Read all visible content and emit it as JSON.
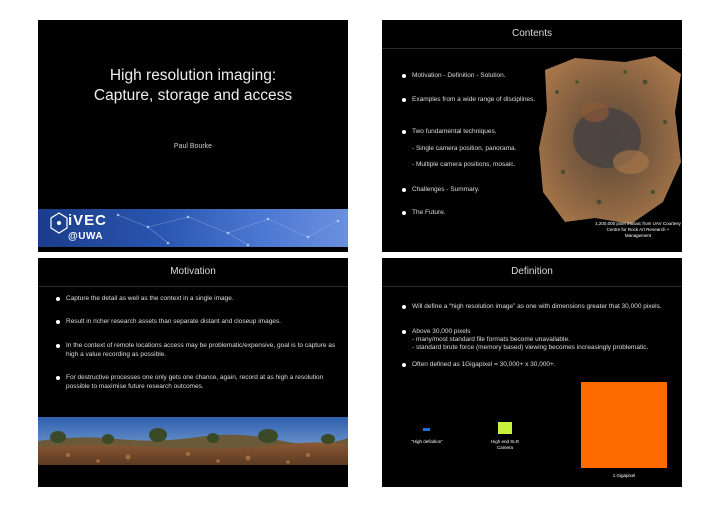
{
  "slide1": {
    "title_line1": "High resolution imaging:",
    "title_line2": "Capture, storage and access",
    "author": "Paul Bourke",
    "logo_top": "iVEC",
    "logo_bottom": "@UWA"
  },
  "slide2": {
    "title": "Contents",
    "bullets": [
      "Motivation - Definition - Solution.",
      "Examples from a wide range of disciplines.",
      "Two fundamental techniques.",
      "- Single camera position, panorama.",
      "- Multiple camera positions, mosaic.",
      "Challenges - Summary.",
      "The Future."
    ],
    "caption": "1,200,000 pixel mosaic from UAV Courtesy Centre for Rock Art Research + Management"
  },
  "slide3": {
    "title": "Motivation",
    "bullets": [
      "Capture the detail as well as the context in a single image.",
      "Result in richer research assets than separate distant and closeup images.",
      "In the context of remote locations access may be problematic/expensive, goal is to capture as high a value recording as possible.",
      "For destructive processes one only gets one chance, again, record at as high a resolution possible to maximise future research outcomes."
    ]
  },
  "slide4": {
    "title": "Definition",
    "bullets": [
      "Will define a “high resolution image” as one with dimensions greater that 30,000 pixels.",
      "Above 30,000 pixels",
      "- many/most standard file formats become unavailable.",
      "- standard brute force (memory based) viewing becomes increasingly problematic.",
      "Often defined as 1Gigapixel = 30,000+ x 30,000+."
    ],
    "labels": {
      "hd": "“High definition”",
      "slr": "High end SLR Camera",
      "giga": "1 Gigapixel"
    },
    "colors": {
      "hd": "#1e6fd8",
      "slr": "#c6f23a",
      "giga": "#ff6a00"
    }
  }
}
